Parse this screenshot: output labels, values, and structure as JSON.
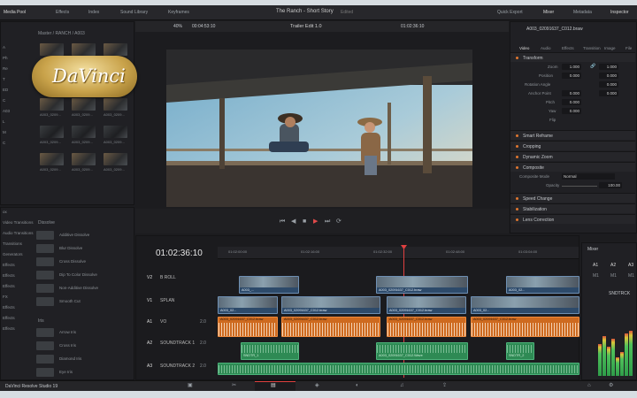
{
  "topbar": {
    "media_pool": "Media Pool",
    "effects": "Effects",
    "index": "Index",
    "sound_library": "Sound Library",
    "keyframes": "Keyframes",
    "project_title": "The Ranch - Short Story",
    "edited": "Edited",
    "quick_export": "Quick Export",
    "mixer": "Mixer",
    "metadata": "Metadata",
    "inspector": "Inspector"
  },
  "viewer_bar": {
    "zoom": "40%",
    "source_timecode": "00:04:53:10",
    "timeline_name": "Trailer Edit 1.0",
    "record_timecode": "01:02:36:10"
  },
  "inspector": {
    "clip_name": "A003_02091637_C012.braw",
    "tabs": [
      "Video",
      "Audio",
      "Effects",
      "Transition",
      "Image",
      "File"
    ],
    "transform_label": "Transform",
    "zoom_label": "Zoom",
    "zoom_x": "1.000",
    "zoom_y": "1.000",
    "position_label": "Position",
    "position_x": "0.000",
    "position_y": "0.000",
    "rotation_label": "Rotation Angle",
    "rotation": "0.000",
    "anchor_label": "Anchor Point",
    "anchor_x": "0.000",
    "anchor_y": "0.000",
    "pitch_label": "Pitch",
    "pitch": "0.000",
    "yaw_label": "Yaw",
    "yaw": "0.000",
    "flip_label": "Flip",
    "sections": [
      "Smart Reframe",
      "Cropping",
      "Dynamic Zoom",
      "Composite",
      "Speed Change",
      "Stabilization",
      "Lens Correction"
    ],
    "composite_mode_label": "Composite Mode",
    "composite_mode": "Normal",
    "opacity_label": "Opacity",
    "opacity": "100.00"
  },
  "media_pool": {
    "path": "Master / RANCH / A003",
    "clips": [
      "A003_0209...",
      "A003_0209...",
      "A003_0209...",
      "A003_0209...",
      "A003_0209...",
      "A003_0209...",
      "A003_0209...",
      "A003_0209...",
      "A003_0209...",
      "A003_0209...",
      "A003_0209...",
      "A003_0209...",
      "A003_0209...",
      "A003_0209...",
      "A003_0209..."
    ],
    "side_items": [
      "A",
      "Ph",
      "Re",
      "T",
      "ED",
      "C",
      "A03",
      "L",
      "M",
      "C"
    ]
  },
  "effects_lib": {
    "dissolve_header": "Dissolve",
    "dissolve_items": [
      "Additive Dissolve",
      "Blur Dissolve",
      "Cross Dissolve",
      "Dip To Color Dissolve",
      "Non-Additive Dissolve",
      "Smooth Cut"
    ],
    "iris_header": "Iris",
    "iris_items": [
      "Arrow Iris",
      "Cross Iris",
      "Diamond Iris",
      "Eye Iris"
    ],
    "side_items": [
      "ox",
      "Video Transitions",
      "Audio Transitions",
      "Transitions",
      "Generators",
      "Effects",
      "Effects",
      "Effects",
      "FX",
      "Effects",
      "Effects",
      "Effects"
    ]
  },
  "timeline": {
    "timecode": "01:02:36:10",
    "ruler": [
      "01:02:00:00",
      "01:02:16:00",
      "01:02:32:00",
      "01:02:48:00",
      "01:03:04:00"
    ],
    "tracks": [
      {
        "id": "V2",
        "name": "B ROLL"
      },
      {
        "id": "V1",
        "name": "SPLAN"
      },
      {
        "id": "A1",
        "name": "VO",
        "channels": "2.0"
      },
      {
        "id": "A2",
        "name": "SOUNDTRACK 1",
        "channels": "2.0"
      },
      {
        "id": "A3",
        "name": "SOUNDTRACK 2",
        "channels": "2.0"
      }
    ],
    "v2_clips": [
      "A003_...",
      "A003_02091637_C012.braw",
      "A003_02..."
    ],
    "v1_clips": [
      "A003_02...",
      "A003_02091637_C012.braw",
      "A003_02091637_C012.braw",
      "A003_02..."
    ],
    "a1_clips": [
      "A003_02091637_C012.braw",
      "A003_02091637_C012.braw",
      "A003_02091637_C012.braw",
      "A003_02091637_C012.braw"
    ],
    "a2_clips": [
      "SNDTR_1",
      "A003_02091637_C012.Wave",
      "SNDTR_2"
    ]
  },
  "mixer": {
    "title": "Mixer",
    "channels": [
      "A1",
      "A2",
      "A3"
    ],
    "m1": "M1",
    "main_label": "SNDTRCK",
    "meter_levels": [
      0.6,
      0.75,
      0.55,
      0.7,
      0.35,
      0.45,
      0.8,
      0.85
    ]
  },
  "watermark": {
    "text": "DaVinci"
  },
  "footer": {
    "app": "DaVinci Resolve Studio 19"
  },
  "colors": {
    "accent": "#e0762f",
    "video_clip": "#3e5f82",
    "audio_clip": "#ce6a1f",
    "soundtrack_clip": "#2e8a54",
    "playhead": "#e04040"
  }
}
